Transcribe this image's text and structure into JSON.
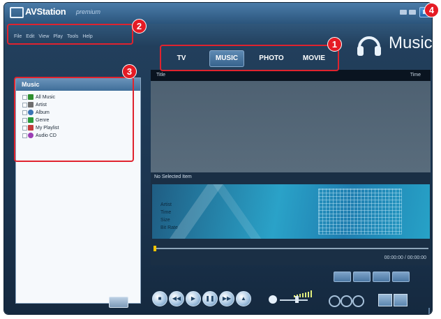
{
  "window": {
    "app_name": "AVStation",
    "edition": "premium",
    "min_icon": "minimize-icon",
    "max_icon": "maximize-icon",
    "close_icon": "close-icon"
  },
  "menubar": {
    "items": [
      "File",
      "Edit",
      "View",
      "Play",
      "Tools",
      "Help"
    ]
  },
  "tabs": [
    {
      "label": "TV"
    },
    {
      "label": "MUSIC"
    },
    {
      "label": "PHOTO"
    },
    {
      "label": "MOVIE"
    }
  ],
  "header": {
    "title": "Music",
    "icon": "headphones-icon"
  },
  "library": {
    "title": "Music",
    "items": [
      {
        "label": "All Music",
        "icon": "music-note-icon",
        "color": "#2f8f2f"
      },
      {
        "label": "Artist",
        "icon": "person-icon",
        "color": "#6e6e6e"
      },
      {
        "label": "Album",
        "icon": "disc-icon",
        "color": "#3a74b5"
      },
      {
        "label": "Genre",
        "icon": "genre-icon",
        "color": "#2b9a3a"
      },
      {
        "label": "My Playlist",
        "icon": "playlist-icon",
        "color": "#c43b3b"
      },
      {
        "label": "Audio CD",
        "icon": "cd-icon",
        "color": "#9b3fb5"
      }
    ]
  },
  "list": {
    "columns": [
      "Title",
      "Time"
    ]
  },
  "selection": {
    "label": "No Selected Item"
  },
  "info": {
    "fields": [
      "Artist",
      "Time",
      "Size",
      "Bit Rate"
    ]
  },
  "playback": {
    "time": "00:00:00 / 00:00:00"
  },
  "annotations": [
    "1",
    "2",
    "3",
    "4"
  ],
  "colors": {
    "annotation_red": "#e0232e",
    "background": "#1b3550",
    "accent": "#2aa2c8"
  }
}
